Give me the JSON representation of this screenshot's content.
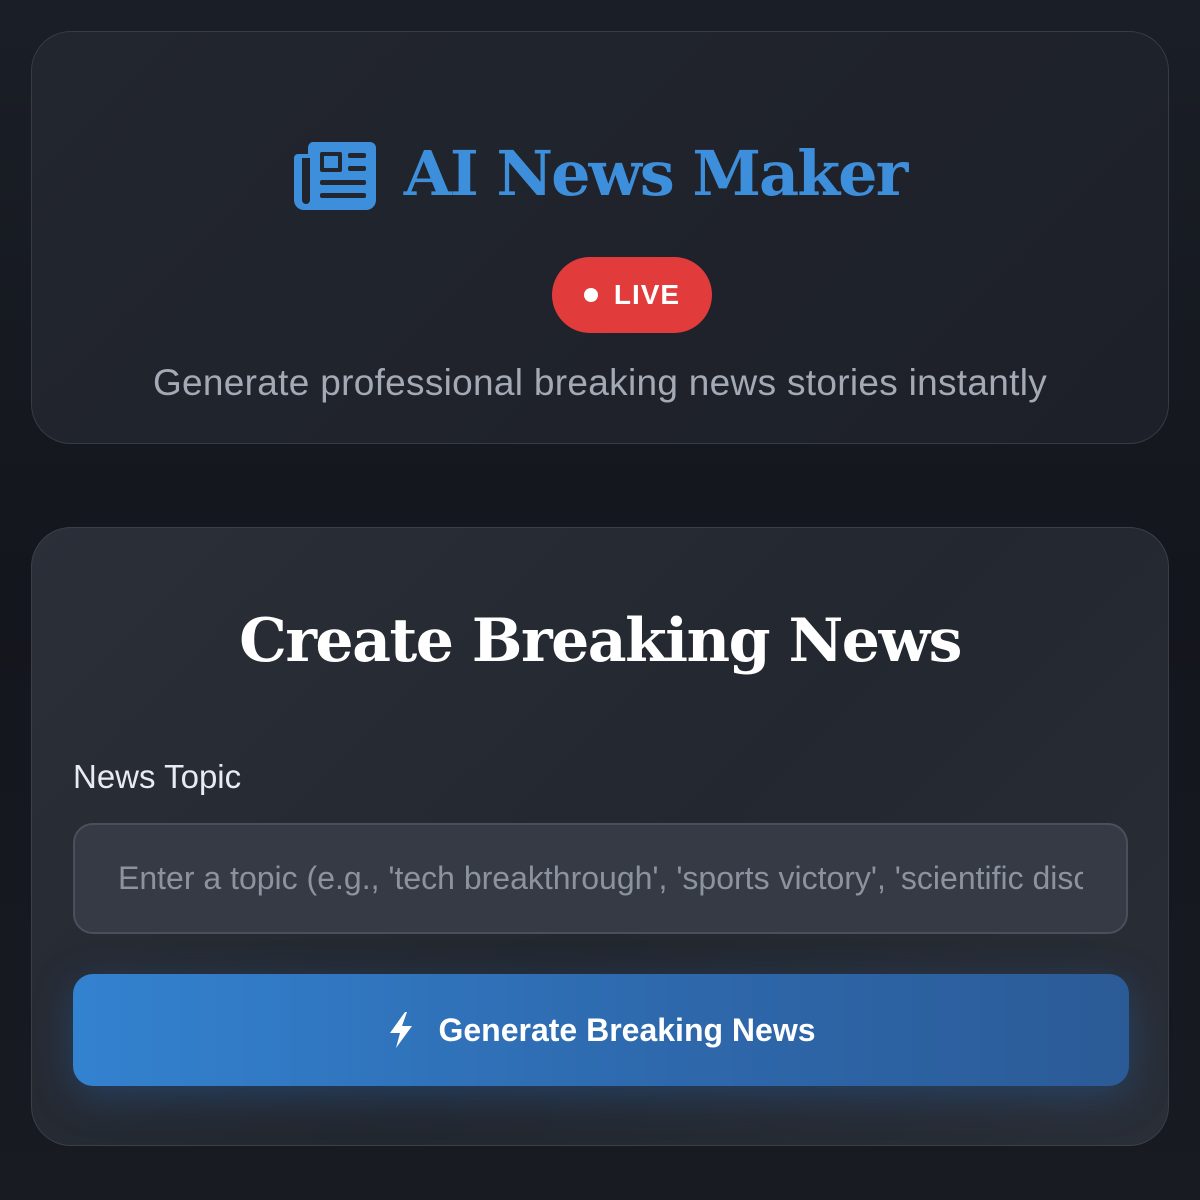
{
  "header": {
    "icon": "newspaper-icon",
    "title": "AI News Maker",
    "badge": "LIVE",
    "tagline": "Generate professional breaking news stories instantly"
  },
  "form": {
    "title": "Create Breaking News",
    "topic_label": "News Topic",
    "topic_value": "",
    "topic_placeholder": "Enter a topic (e.g., 'tech breakthrough', 'sports victory', 'scientific discovery')",
    "generate_icon": "bolt-icon",
    "generate_label": "Generate Breaking News"
  },
  "colors": {
    "accent": "#3e8fdb",
    "live_badge": "#e23b3b",
    "button_start": "#3382d0",
    "button_end": "#2b5b97",
    "background": "#171a21"
  }
}
